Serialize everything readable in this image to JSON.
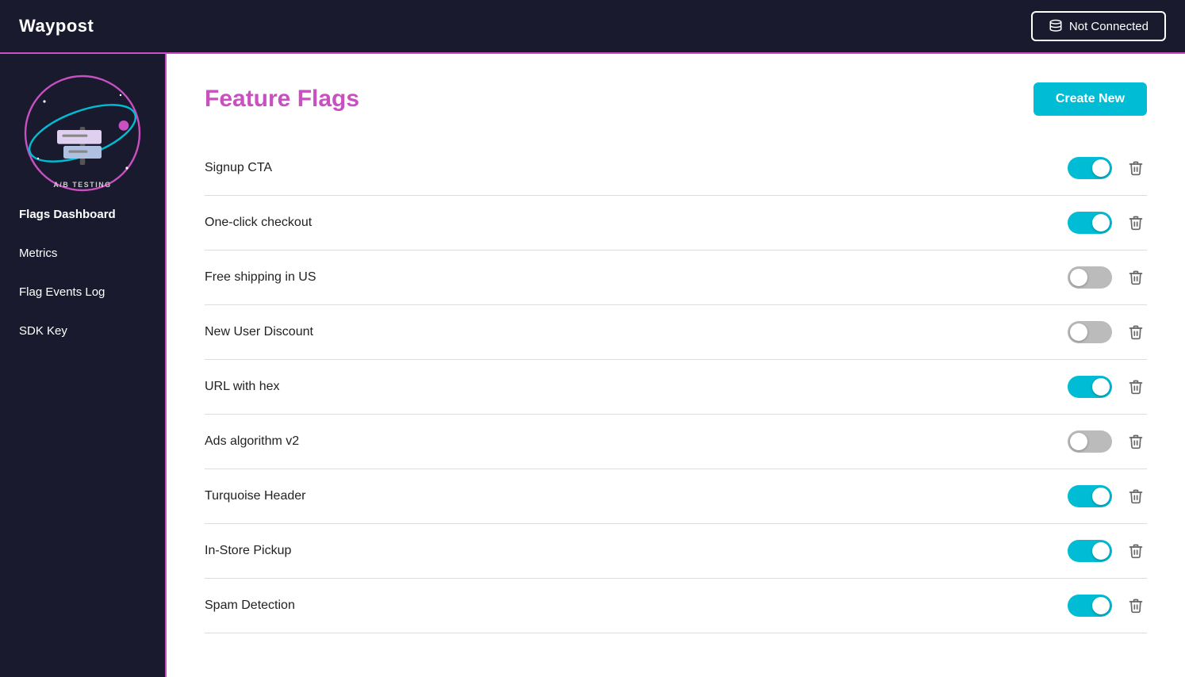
{
  "header": {
    "logo_text": "Waypost",
    "connection_button_label": "Not Connected",
    "connection_icon": "database-icon"
  },
  "sidebar": {
    "nav_items": [
      {
        "id": "flags-dashboard",
        "label": "Flags Dashboard",
        "active": true
      },
      {
        "id": "metrics",
        "label": "Metrics",
        "active": false
      },
      {
        "id": "flag-events-log",
        "label": "Flag Events Log",
        "active": false
      },
      {
        "id": "sdk-key",
        "label": "SDK Key",
        "active": false
      }
    ]
  },
  "main": {
    "page_title": "Feature Flags",
    "create_new_label": "Create New",
    "flags": [
      {
        "id": "signup-cta",
        "name": "Signup CTA",
        "enabled": true
      },
      {
        "id": "one-click-checkout",
        "name": "One-click checkout",
        "enabled": true
      },
      {
        "id": "free-shipping-us",
        "name": "Free shipping in US",
        "enabled": false
      },
      {
        "id": "new-user-discount",
        "name": "New User Discount",
        "enabled": false
      },
      {
        "id": "url-with-hex",
        "name": "URL with hex",
        "enabled": true
      },
      {
        "id": "ads-algorithm-v2",
        "name": "Ads algorithm v2",
        "enabled": false
      },
      {
        "id": "turquoise-header",
        "name": "Turquoise Header",
        "enabled": true
      },
      {
        "id": "in-store-pickup",
        "name": "In-Store Pickup",
        "enabled": true
      },
      {
        "id": "spam-detection",
        "name": "Spam Detection",
        "enabled": true
      }
    ]
  },
  "colors": {
    "accent_pink": "#c850c0",
    "accent_teal": "#00bcd4",
    "sidebar_bg": "#1a1a2e",
    "header_bg": "#1a1a2e",
    "toggle_on": "#00bcd4",
    "toggle_off": "#bbbbbb"
  }
}
